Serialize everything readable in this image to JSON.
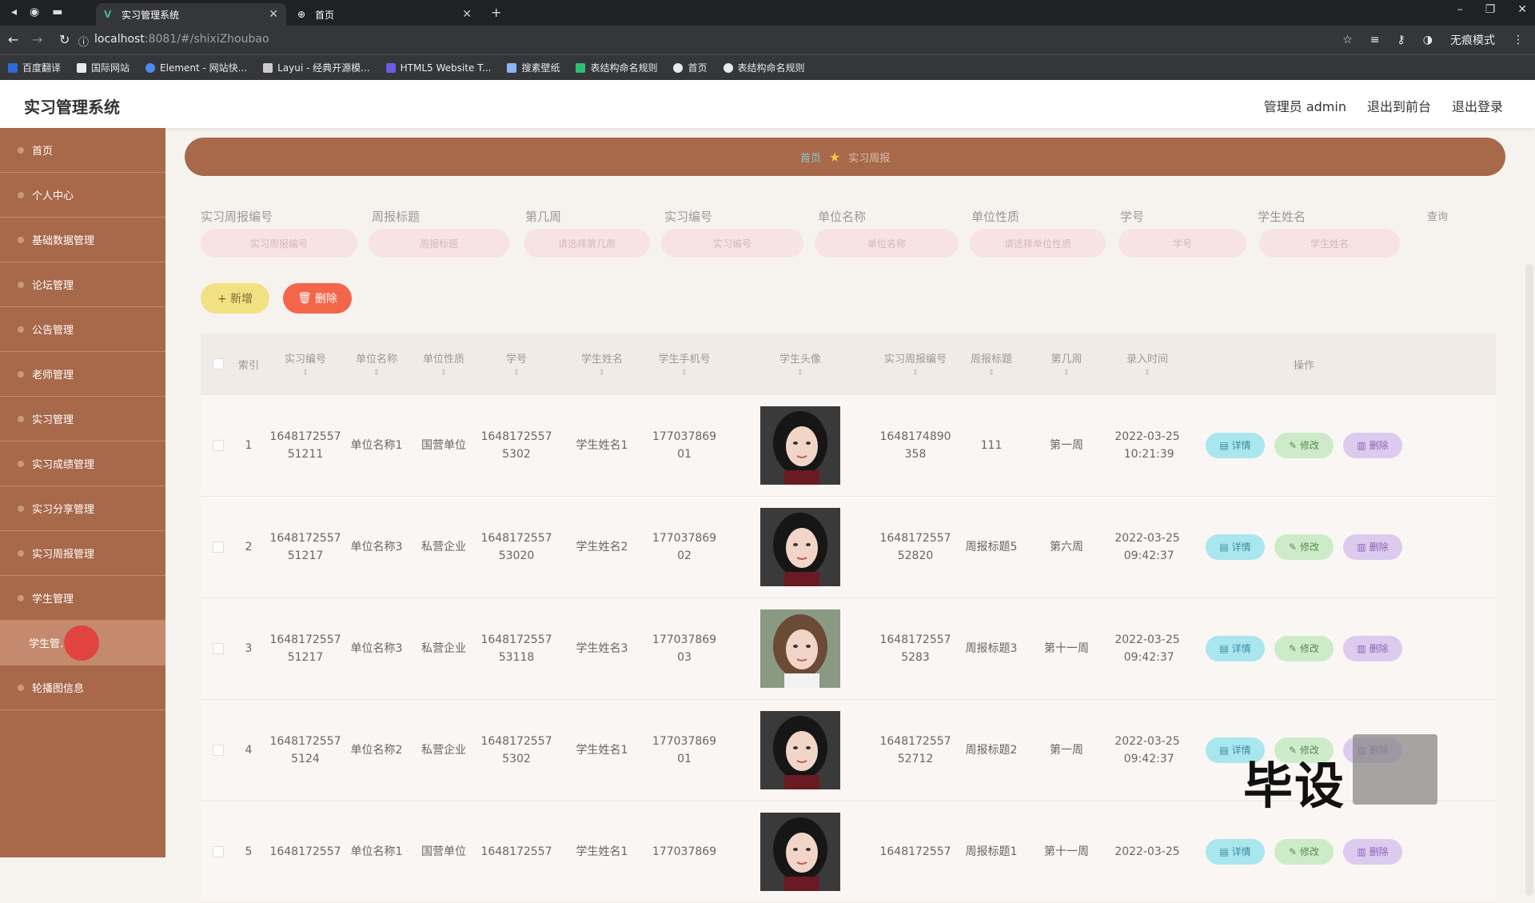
{
  "browser": {
    "tabs": [
      {
        "title": "实习管理系统",
        "active": true
      },
      {
        "title": "首页",
        "active": false
      }
    ],
    "url_host": "localhost",
    "url_rest": ":8081/#/shixiZhoubao",
    "incognito_label": "无痕模式",
    "bookmarks": [
      "百度翻译",
      "国际网站",
      "Element - 网站快...",
      "Layui - 经典开源模...",
      "HTML5 Website T...",
      "搜素壁纸",
      "表结构命名规则",
      "首页",
      "表结构命名规则"
    ]
  },
  "header": {
    "title": "实习管理系统",
    "links": [
      "管理员 admin",
      "退出到前台",
      "退出登录"
    ]
  },
  "sidebar": {
    "items": [
      {
        "label": "首页"
      },
      {
        "label": "个人中心"
      },
      {
        "label": "基础数据管理"
      },
      {
        "label": "论坛管理"
      },
      {
        "label": "公告管理"
      },
      {
        "label": "老师管理"
      },
      {
        "label": "实习管理"
      },
      {
        "label": "实习成绩管理"
      },
      {
        "label": "实习分享管理"
      },
      {
        "label": "实习周报管理"
      },
      {
        "label": "学生管理"
      },
      {
        "label": "学生管..."
      },
      {
        "label": "轮播图信息"
      }
    ]
  },
  "breadcrumb": {
    "home": "首页",
    "current": "实习周报"
  },
  "search": {
    "labels": [
      "实习周报编号",
      "周报标题",
      "第几周",
      "实习编号",
      "单位名称",
      "单位性质",
      "学号",
      "学生姓名"
    ],
    "placeholders": [
      "实习周报编号",
      "周报标题",
      "请选择第几周",
      "实习编号",
      "单位名称",
      "请选择单位性质",
      "学号",
      "学生姓名"
    ],
    "query_label": "查询"
  },
  "actions": {
    "add_label": "+ 新增",
    "delete_label": "删除"
  },
  "table": {
    "headers": [
      "索引",
      "实习编号",
      "单位名称",
      "单位性质",
      "学号",
      "学生姓名",
      "学生手机号",
      "学生头像",
      "实习周报编号",
      "周报标题",
      "第几周",
      "录入时间",
      "操作"
    ],
    "row_actions": {
      "detail": "详情",
      "edit": "修改",
      "delete": "删除"
    },
    "rows": [
      {
        "index": "1",
        "shixi_no": "164817255751211",
        "unit": "单位名称1",
        "nature": "国营单位",
        "xuehao": "16481725575302",
        "name": "学生姓名1",
        "phone": "17703786901",
        "avatar": "girl-dark",
        "zhoubao_no": "1648174890358",
        "title": "111",
        "week": "第一周",
        "time": "2022-03-25 10:21:39"
      },
      {
        "index": "2",
        "shixi_no": "164817255751217",
        "unit": "单位名称3",
        "nature": "私营企业",
        "xuehao": "164817255753020",
        "name": "学生姓名2",
        "phone": "17703786902",
        "avatar": "girl-dark",
        "zhoubao_no": "164817255752820",
        "title": "周报标题5",
        "week": "第六周",
        "time": "2022-03-25 09:42:37"
      },
      {
        "index": "3",
        "shixi_no": "164817255751217",
        "unit": "单位名称3",
        "nature": "私营企业",
        "xuehao": "164817255753118",
        "name": "学生姓名3",
        "phone": "17703786903",
        "avatar": "girl-light",
        "zhoubao_no": "16481725575283",
        "title": "周报标题3",
        "week": "第十一周",
        "time": "2022-03-25 09:42:37"
      },
      {
        "index": "4",
        "shixi_no": "16481725575124",
        "unit": "单位名称2",
        "nature": "私营企业",
        "xuehao": "16481725575302",
        "name": "学生姓名1",
        "phone": "17703786901",
        "avatar": "girl-dark",
        "zhoubao_no": "164817255752712",
        "title": "周报标题2",
        "week": "第一周",
        "time": "2022-03-25 09:42:37"
      },
      {
        "index": "5",
        "shixi_no": "1648172557",
        "unit": "单位名称1",
        "nature": "国营单位",
        "xuehao": "1648172557",
        "name": "学生姓名1",
        "phone": "177037869",
        "avatar": "girl-dark",
        "zhoubao_no": "1648172557",
        "title": "周报标题1",
        "week": "第十一周",
        "time": "2022-03-25"
      }
    ]
  },
  "watermark": "毕设",
  "colors": {
    "sidebar": "#a8684a",
    "accent_add": "#f2e183",
    "accent_delete": "#f3664a"
  }
}
